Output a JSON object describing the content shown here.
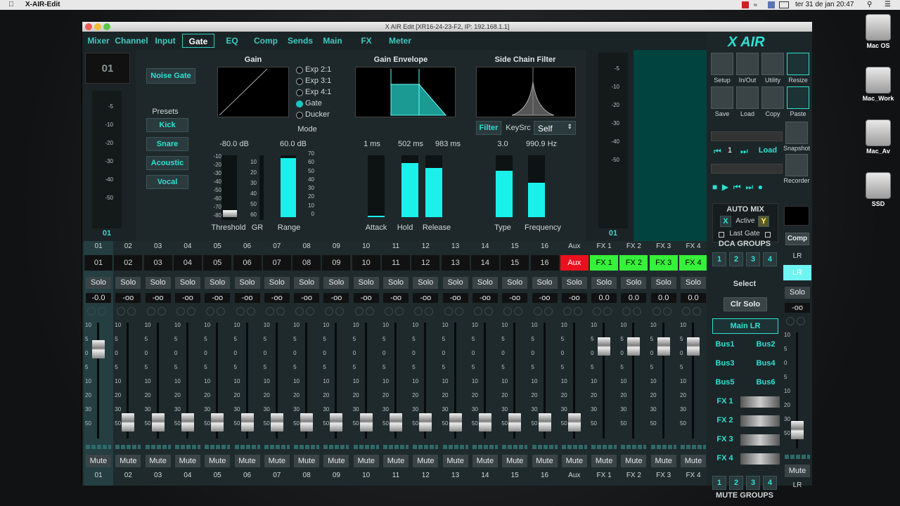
{
  "menubar": {
    "apple": "",
    "app": "X-AIR-Edit",
    "clock": "ter 31 de jan  20:47"
  },
  "desktop": {
    "icons": [
      "Mac OS",
      "Mac_Work",
      "Mac_Av",
      "SSD"
    ]
  },
  "window": {
    "title": "X AIR Edit [XR16-24-23-F2, IP: 192.168.1.1]"
  },
  "tabs": [
    "Mixer",
    "Channel",
    "Input",
    "Gate",
    "EQ",
    "Comp",
    "Sends",
    "Main",
    "FX",
    "Meter"
  ],
  "gate": {
    "channel": "01",
    "noise_gate": "Noise Gate",
    "presets_label": "Presets",
    "presets": [
      "Kick",
      "Snare",
      "Acoustic",
      "Vocal"
    ],
    "gain_header": "Gain",
    "modes": [
      "Exp 2:1",
      "Exp 3:1",
      "Exp 4:1",
      "Gate",
      "Ducker"
    ],
    "mode_selected": 3,
    "mode_label": "Mode",
    "envelope_header": "Gain Envelope",
    "sidechain_header": "Side Chain Filter",
    "threshold_value": "-80.0 dB",
    "range_value": "60.0 dB",
    "attack_value": "1 ms",
    "hold_value": "502 ms",
    "release_value": "983 ms",
    "type_value": "3.0",
    "freq_value": "990.9 Hz",
    "labels": [
      "Threshold",
      "GR",
      "Range",
      "Attack",
      "Hold",
      "Release",
      "Type",
      "Frequency"
    ],
    "filter_btn": "Filter",
    "keysrc_label": "KeySrc",
    "keysrc_value": "Self",
    "left_meter_label": "01",
    "right_meter_label": "01",
    "meter_ticks": [
      "-5",
      "-10",
      "-20",
      "-30",
      "-40",
      "-50"
    ],
    "gr_ticks": [
      "10",
      "20",
      "30",
      "40",
      "50",
      "60"
    ],
    "range_ticks": [
      "70",
      "60",
      "50",
      "40",
      "30",
      "20",
      "10",
      "0"
    ],
    "thr_ticks": [
      "-10",
      "-20",
      "-30",
      "-40",
      "-50",
      "-60",
      "-70",
      "-80"
    ],
    "levels": {
      "range": 0.95,
      "attack": 0.02,
      "hold": 0.88,
      "release": 0.8,
      "type": 0.75,
      "freq": 0.56
    }
  },
  "channels": [
    {
      "num": "01",
      "name": "01",
      "gain": "-0.0",
      "bot": "01"
    },
    {
      "num": "02",
      "name": "02",
      "gain": "-oo",
      "bot": "02"
    },
    {
      "num": "03",
      "name": "03",
      "gain": "-oo",
      "bot": "03"
    },
    {
      "num": "04",
      "name": "04",
      "gain": "-oo",
      "bot": "04"
    },
    {
      "num": "05",
      "name": "05",
      "gain": "-oo",
      "bot": "05"
    },
    {
      "num": "06",
      "name": "06",
      "gain": "-oo",
      "bot": "06"
    },
    {
      "num": "07",
      "name": "07",
      "gain": "-oo",
      "bot": "07"
    },
    {
      "num": "08",
      "name": "08",
      "gain": "-oo",
      "bot": "08"
    },
    {
      "num": "09",
      "name": "09",
      "gain": "-oo",
      "bot": "09"
    },
    {
      "num": "10",
      "name": "10",
      "gain": "-oo",
      "bot": "10"
    },
    {
      "num": "11",
      "name": "11",
      "gain": "-oo",
      "bot": "11"
    },
    {
      "num": "12",
      "name": "12",
      "gain": "-oo",
      "bot": "12"
    },
    {
      "num": "13",
      "name": "13",
      "gain": "-oo",
      "bot": "13"
    },
    {
      "num": "14",
      "name": "14",
      "gain": "-oo",
      "bot": "14"
    },
    {
      "num": "15",
      "name": "15",
      "gain": "-oo",
      "bot": "15"
    },
    {
      "num": "16",
      "name": "16",
      "gain": "-oo",
      "bot": "16"
    },
    {
      "num": "Aux",
      "name": "Aux",
      "gain": "-oo",
      "bot": "Aux"
    },
    {
      "num": "FX 1",
      "name": "FX 1",
      "gain": "0.0",
      "bot": "FX 1"
    },
    {
      "num": "FX 2",
      "name": "FX 2",
      "gain": "0.0",
      "bot": "FX 2"
    },
    {
      "num": "FX 3",
      "name": "FX 3",
      "gain": "0.0",
      "bot": "FX 3"
    },
    {
      "num": "FX 4",
      "name": "FX 4",
      "gain": "0.0",
      "bot": "FX 4"
    }
  ],
  "fader_levels": [
    0.82,
    0.08,
    0.08,
    0.08,
    0.08,
    0.08,
    0.08,
    0.08,
    0.08,
    0.08,
    0.08,
    0.08,
    0.08,
    0.08,
    0.08,
    0.08,
    0.08,
    0.85,
    0.85,
    0.85,
    0.85
  ],
  "solo_label": "Solo",
  "mute_label": "Mute",
  "fader_scale": [
    "10",
    "5",
    "0",
    "5",
    "10",
    "20",
    "30",
    "50"
  ],
  "colors": {
    "accent": "#1cc9bf",
    "aux": "#e8111d",
    "fx": "#36f03a",
    "lr": "#6ff3f3"
  },
  "side": {
    "logo": "X AIR",
    "buttons": [
      "Setup",
      "In/Out",
      "Utility",
      "Resize",
      "Save",
      "Load",
      "Copy",
      "Paste"
    ],
    "snapshot": "Snapshot",
    "recorder": "Recorder",
    "load_btn": "Load",
    "snap_num": "1",
    "automix": "AUTO MIX",
    "automix_x": "X",
    "automix_active": "Active",
    "automix_y": "Y",
    "last_gate": "Last Gate",
    "comp": "Comp",
    "dca_groups": "DCA GROUPS",
    "groups": [
      "1",
      "2",
      "3",
      "4"
    ],
    "select": "Select",
    "clr_solo": "Clr Solo",
    "main_lr": "Main LR",
    "buses": [
      "Bus1",
      "Bus2",
      "Bus3",
      "Bus4",
      "Bus5",
      "Bus6"
    ],
    "fx": [
      "FX 1",
      "FX 2",
      "FX 3",
      "FX 4"
    ],
    "mute_groups": "MUTE GROUPS",
    "lr_num": "LR",
    "lr_name": "LR",
    "lr_gain": "-oo",
    "lr_bot": "LR",
    "lr_level": 0.1
  }
}
